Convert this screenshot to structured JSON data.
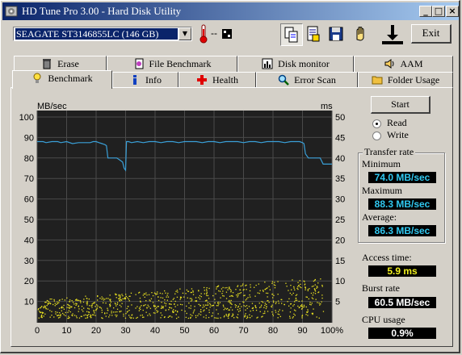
{
  "window": {
    "title": "HD Tune Pro 3.00 - Hard Disk Utility"
  },
  "toolbar": {
    "drive": "SEAGATE ST3146855LC (146 GB)",
    "temperature": "--",
    "exit_label": "Exit",
    "buttons": [
      "copy-icon",
      "copy-text-icon",
      "save-icon",
      "hand-icon",
      "disk-icon"
    ]
  },
  "tabs_top": [
    {
      "label": "Erase",
      "icon": "trash-icon"
    },
    {
      "label": "File Benchmark",
      "icon": "file-benchmark-icon"
    },
    {
      "label": "Disk monitor",
      "icon": "disk-monitor-icon"
    },
    {
      "label": "AAM",
      "icon": "speaker-icon"
    }
  ],
  "tabs_bottom": [
    {
      "label": "Benchmark",
      "icon": "lightbulb-icon"
    },
    {
      "label": "Info",
      "icon": "info-icon"
    },
    {
      "label": "Health",
      "icon": "health-cross-icon"
    },
    {
      "label": "Error Scan",
      "icon": "magnifier-icon"
    },
    {
      "label": "Folder Usage",
      "icon": "folder-icon"
    }
  ],
  "controls": {
    "start_label": "Start",
    "read_label": "Read",
    "write_label": "Write",
    "read_selected": true
  },
  "transfer": {
    "group_title": "Transfer rate",
    "min_label": "Minimum",
    "min_value": "74.0 MB/sec",
    "max_label": "Maximum",
    "max_value": "88.3 MB/sec",
    "avg_label": "Average:",
    "avg_value": "86.3 MB/sec"
  },
  "access": {
    "label": "Access time:",
    "value": "5.9 ms"
  },
  "burst": {
    "label": "Burst rate",
    "value": "60.5 MB/sec"
  },
  "cpu": {
    "label": "CPU usage",
    "value": "0.9%"
  },
  "colors": {
    "line": "#3aa0d8",
    "dots": "#e8e020",
    "plot_bg": "#202020",
    "grid": "#505050",
    "value_cyan": "#30c8f0",
    "value_yellow": "#f0f020",
    "value_white": "#ffffff"
  },
  "chart_data": {
    "type": "line",
    "y_left_label": "MB/sec",
    "y_right_label": "ms",
    "y_left_ticks": [
      "100",
      "90",
      "80",
      "70",
      "60",
      "50",
      "40",
      "30",
      "20",
      "10"
    ],
    "y_right_ticks": [
      "50",
      "45",
      "40",
      "35",
      "30",
      "25",
      "20",
      "15",
      "10",
      "5"
    ],
    "x_ticks": [
      "0",
      "10",
      "20",
      "30",
      "40",
      "50",
      "60",
      "70",
      "80",
      "90",
      "100%"
    ],
    "ylim_left": [
      0,
      100
    ],
    "ylim_right": [
      0,
      50
    ],
    "xlim": [
      0,
      100
    ],
    "series": [
      {
        "values_x": [
          0,
          2,
          3,
          5,
          7,
          8,
          10,
          12,
          14,
          16,
          18,
          19,
          20,
          21,
          22,
          23,
          23.5,
          24,
          25,
          26,
          27,
          28,
          29,
          29.5,
          30,
          30.3,
          30.6,
          31,
          32,
          34,
          36,
          38,
          40,
          42,
          44,
          46,
          48,
          50,
          52,
          54,
          56,
          58,
          60,
          62,
          64,
          66,
          68,
          70,
          72,
          74,
          76,
          78,
          80,
          82,
          84,
          86,
          88,
          89,
          90,
          90.5,
          91,
          92,
          93,
          94,
          95,
          96,
          97,
          98,
          99,
          100
        ],
        "values_y": [
          88,
          88,
          87.5,
          88,
          88,
          87.5,
          88,
          87,
          87.5,
          87.5,
          87.5,
          88,
          88,
          87.5,
          87,
          86.5,
          86,
          80,
          80,
          80,
          80,
          79,
          78,
          75,
          74,
          88,
          88,
          88,
          87.5,
          88,
          87.5,
          88,
          88,
          87.5,
          88,
          88,
          87.5,
          88,
          88,
          88,
          87.5,
          88,
          88,
          87.5,
          88,
          88,
          88,
          87.5,
          88,
          88,
          87.5,
          88,
          88,
          88,
          87.5,
          88,
          88,
          88,
          87.5,
          87,
          82,
          80,
          80,
          80,
          80,
          80,
          77,
          77,
          77,
          77
        ]
      }
    ],
    "scatter_range_ms": [
      1,
      11
    ]
  }
}
